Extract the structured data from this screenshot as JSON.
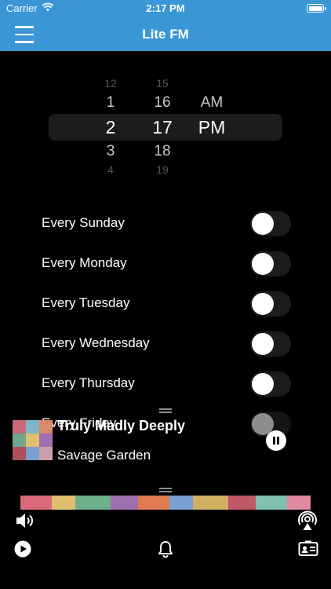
{
  "status_bar": {
    "carrier": "Carrier",
    "time": "2:17 PM",
    "battery_level": 1.0
  },
  "nav": {
    "title": "Lite FM",
    "menu_icon": "hamburger-menu-icon"
  },
  "time_picker": {
    "hours": {
      "faint_above": "12",
      "above": "1",
      "selected": "2",
      "below": "3",
      "faint_below": "4"
    },
    "minutes": {
      "faint_above": "15",
      "above": "16",
      "selected": "17",
      "below": "18",
      "faint_below": "19"
    },
    "period": {
      "above": "AM",
      "selected": "PM"
    }
  },
  "days": [
    {
      "label": "Every Sunday",
      "enabled": false
    },
    {
      "label": "Every Monday",
      "enabled": false
    },
    {
      "label": "Every Tuesday",
      "enabled": false
    },
    {
      "label": "Every Wednesday",
      "enabled": false
    },
    {
      "label": "Every Thursday",
      "enabled": false
    },
    {
      "label": "Every Friday",
      "enabled": false
    }
  ],
  "now_playing": {
    "song": "Truly Madly Deeply",
    "artist": "Savage Garden",
    "state_icon": "pause-icon"
  },
  "controls": {
    "volume_icon": "speaker-volume-icon",
    "airplay_icon": "airplay-icon",
    "play_icon": "play-icon",
    "alarm_icon": "bell-icon",
    "contact_icon": "contact-card-icon"
  },
  "colors": {
    "accent": "#3a96d4",
    "background": "#000000",
    "toggle_off": "#1c1c1e"
  }
}
